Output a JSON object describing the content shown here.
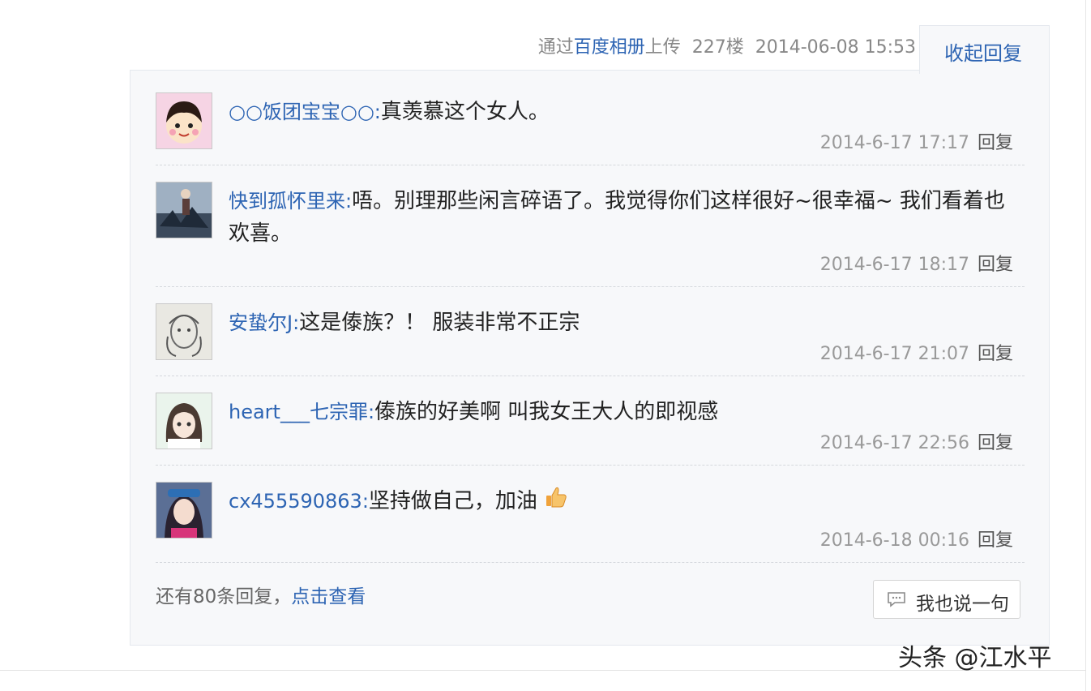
{
  "post_meta": {
    "via": "通过",
    "source": "百度相册",
    "uploaded": "上传",
    "floor": "227楼",
    "datetime": "2014-06-08 15:53"
  },
  "collapse_label": "收起回复",
  "comments": [
    {
      "user": "○○饭团宝宝○○:",
      "text": "真羡慕这个女人。",
      "time": "2014-6-17 17:17",
      "reply": "回复",
      "avatar": "cartoon-girl-avatar"
    },
    {
      "user": "快到孤怀里来:",
      "text": "唔。别理那些闲言碎语了。我觉得你们这样很好~很幸福~ 我们看着也欢喜。",
      "time": "2014-6-17 18:17",
      "reply": "回复",
      "avatar": "photo-avatar"
    },
    {
      "user": "安蛰尔J:",
      "text": "这是傣族？！ 服装非常不正宗",
      "time": "2014-6-17 21:07",
      "reply": "回复",
      "avatar": "sketch-avatar"
    },
    {
      "user": "heart___七宗罪:",
      "text": "傣族的好美啊 叫我女王大人的即视感",
      "time": "2014-6-17 22:56",
      "reply": "回复",
      "avatar": "anime-girl-avatar"
    },
    {
      "user": "cx455590863:",
      "text": "坚持做自己，加油",
      "time": "2014-6-18 00:16",
      "reply": "回复",
      "avatar": "selfie-avatar",
      "emoji": "thumbs-up-icon"
    }
  ],
  "more_replies": {
    "prefix": "还有80条回复，",
    "link": "点击查看"
  },
  "say_button": "我也说一句",
  "watermark": "头条 @江水平",
  "colors": {
    "link": "#2d64b3",
    "meta": "#999999",
    "panel_bg": "#f7f8fa"
  }
}
